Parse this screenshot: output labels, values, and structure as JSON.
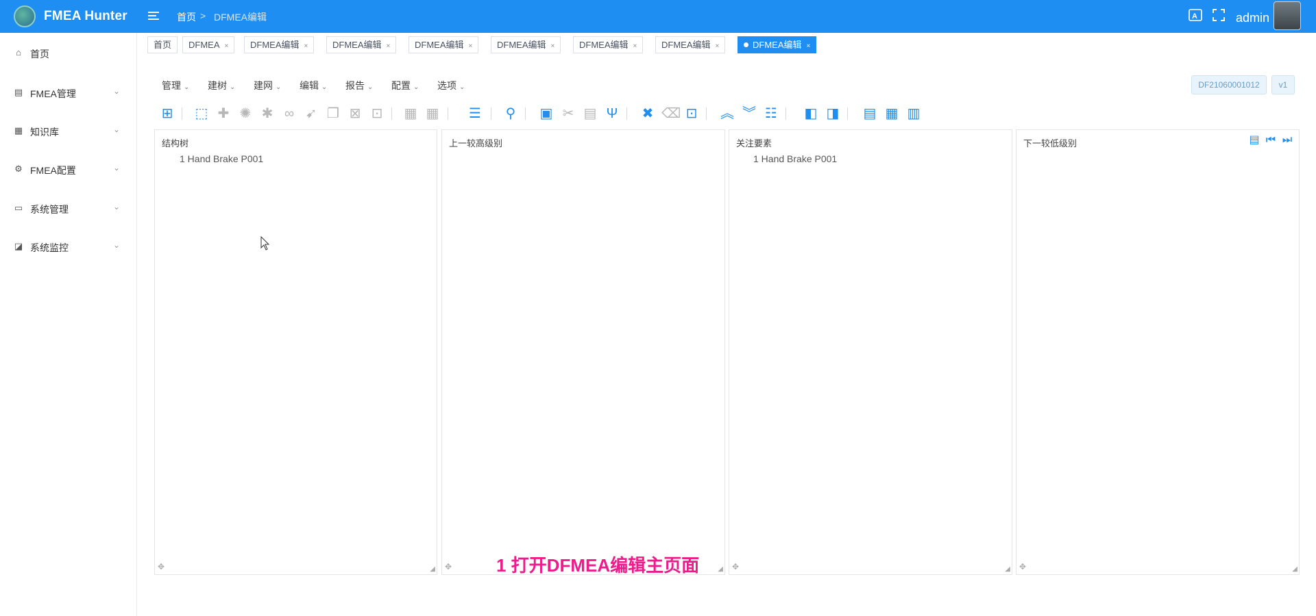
{
  "header": {
    "app_title": "FMEA Hunter",
    "breadcrumb_home": "首页",
    "breadcrumb_sep": ">",
    "breadcrumb_current": "DFMEA编辑",
    "user": "admin",
    "brand_color": "#1f8ef2"
  },
  "sidebar": {
    "items": [
      {
        "label": "首页",
        "icon": "home-icon",
        "glyph": "⌂"
      },
      {
        "label": "FMEA管理",
        "icon": "document-icon",
        "glyph": "▤"
      },
      {
        "label": "知识库",
        "icon": "book-icon",
        "glyph": "▦"
      },
      {
        "label": "FMEA配置",
        "icon": "settings-icon",
        "glyph": "⚙"
      },
      {
        "label": "系统管理",
        "icon": "monitor-icon",
        "glyph": "▭"
      },
      {
        "label": "系统监控",
        "icon": "chart-icon",
        "glyph": "◪"
      }
    ],
    "chevron": "⌄"
  },
  "tags": [
    {
      "label": "首页",
      "closable": false,
      "active": false
    },
    {
      "label": "DFMEA",
      "closable": true,
      "active": false
    },
    {
      "label": "DFMEA编辑",
      "closable": true,
      "active": false
    },
    {
      "label": "DFMEA编辑",
      "closable": true,
      "active": false
    },
    {
      "label": "DFMEA编辑",
      "closable": true,
      "active": false
    },
    {
      "label": "DFMEA编辑",
      "closable": true,
      "active": false
    },
    {
      "label": "DFMEA编辑",
      "closable": true,
      "active": false
    },
    {
      "label": "DFMEA编辑",
      "closable": true,
      "active": false
    },
    {
      "label": "DFMEA编辑",
      "closable": true,
      "active": true
    }
  ],
  "tag_close": "×",
  "menubar": {
    "items": [
      "管理",
      "建树",
      "建网",
      "编辑",
      "报告",
      "配置",
      "选项"
    ],
    "caret": "⌄"
  },
  "doc_code": "DF21060001012",
  "doc_version": "v1",
  "toolbar": {
    "buttons": [
      {
        "icon": "add-structure-icon",
        "glyph": "⊞",
        "enabled": true
      },
      {
        "icon": "node-select-icon",
        "glyph": "⬚",
        "enabled": true
      },
      {
        "icon": "puzzle-icon",
        "glyph": "✚",
        "enabled": false
      },
      {
        "icon": "gear-icon",
        "glyph": "✺",
        "enabled": false
      },
      {
        "icon": "asterisk-icon",
        "glyph": "✱",
        "enabled": false
      },
      {
        "icon": "link-icon",
        "glyph": "∞",
        "enabled": false
      },
      {
        "icon": "pointer-icon",
        "glyph": "➹",
        "enabled": false
      },
      {
        "icon": "copy-icon",
        "glyph": "❐",
        "enabled": false
      },
      {
        "icon": "delete-box-icon",
        "glyph": "⊠",
        "enabled": false
      },
      {
        "icon": "search-box-icon",
        "glyph": "⊡",
        "enabled": false
      },
      {
        "icon": "grid-icon",
        "glyph": "▦",
        "enabled": false
      },
      {
        "icon": "grid-alt-icon",
        "glyph": "▦",
        "enabled": false
      },
      {
        "icon": "list-icon",
        "glyph": "☰",
        "enabled": true
      },
      {
        "icon": "search-icon",
        "glyph": "⚲",
        "enabled": true
      },
      {
        "icon": "paste-icon",
        "glyph": "▣",
        "enabled": true
      },
      {
        "icon": "cut-icon",
        "glyph": "✂",
        "enabled": false
      },
      {
        "icon": "clipboard-icon",
        "glyph": "▤",
        "enabled": false
      },
      {
        "icon": "fork-icon",
        "glyph": "Ψ",
        "enabled": true
      },
      {
        "icon": "close-icon",
        "glyph": "✖",
        "enabled": true
      },
      {
        "icon": "backspace-icon",
        "glyph": "⌫",
        "enabled": false
      },
      {
        "icon": "focus-icon",
        "glyph": "⊡",
        "enabled": true
      },
      {
        "icon": "collapse-up-icon",
        "glyph": "︽",
        "enabled": true
      },
      {
        "icon": "expand-down-icon",
        "glyph": "︾",
        "enabled": true
      },
      {
        "icon": "numbered-list-icon",
        "glyph": "☷",
        "enabled": true
      },
      {
        "icon": "split-left-icon",
        "glyph": "◧",
        "enabled": true
      },
      {
        "icon": "split-right-icon",
        "glyph": "◨",
        "enabled": true
      },
      {
        "icon": "table-icon",
        "glyph": "▤",
        "enabled": true
      },
      {
        "icon": "matrix-icon",
        "glyph": "▦",
        "enabled": true
      },
      {
        "icon": "calendar-icon",
        "glyph": "▥",
        "enabled": true
      }
    ]
  },
  "panels": {
    "tree": {
      "title": "结构树",
      "node": "1 Hand Brake P001"
    },
    "higher": {
      "title": "上一较高级别"
    },
    "focus": {
      "title": "关注要素",
      "node": "1 Hand Brake P001"
    },
    "lower": {
      "title": "下一较低级别"
    }
  },
  "panel_tools": [
    {
      "icon": "table-view-icon",
      "glyph": "▤"
    },
    {
      "icon": "skip-first-icon",
      "glyph": "⏮"
    },
    {
      "icon": "skip-last-icon",
      "glyph": "⏭"
    }
  ],
  "caption": "1 打开DFMEA编辑主页面",
  "caption_color": "#ee1b8a"
}
